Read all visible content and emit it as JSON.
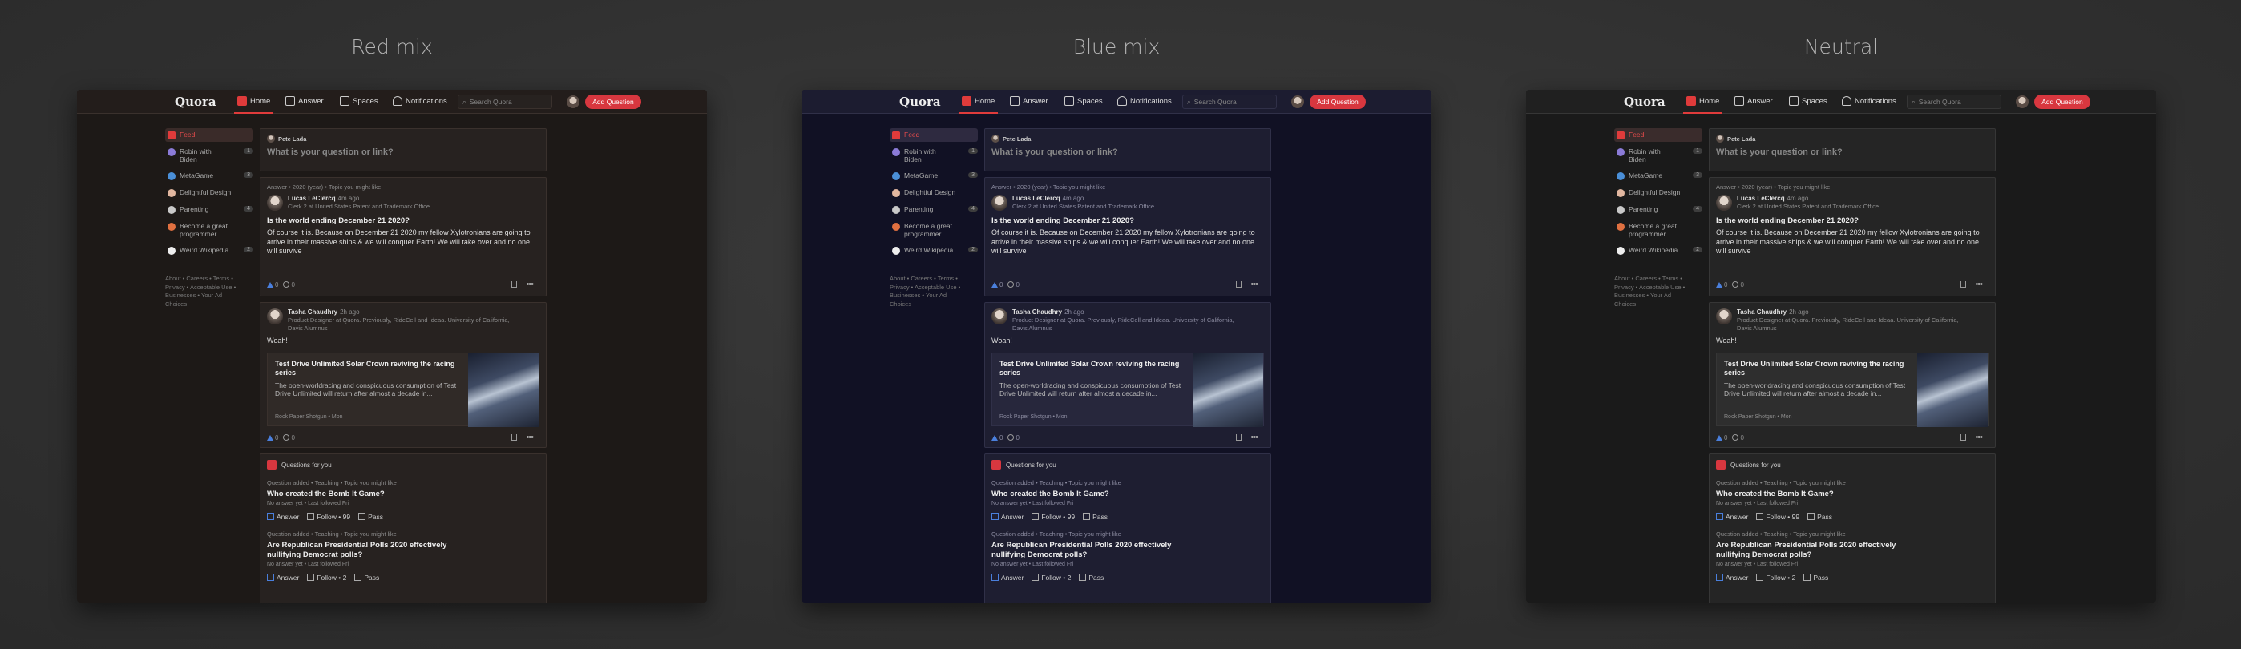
{
  "panels": [
    {
      "id": "red",
      "title": "Red mix"
    },
    {
      "id": "blue",
      "title": "Blue mix"
    },
    {
      "id": "neutral",
      "title": "Neutral"
    }
  ],
  "header": {
    "logo": "Quora",
    "nav": [
      "Home",
      "Answer",
      "Spaces",
      "Notifications"
    ],
    "search_placeholder": "Search Quora",
    "add_question": "Add Question"
  },
  "sidebar": {
    "items": [
      {
        "label": "Feed",
        "count": ""
      },
      {
        "label": "Robin with Biden",
        "count": "1"
      },
      {
        "label": "MetaGame",
        "count": "3"
      },
      {
        "label": "Delightful Design",
        "count": ""
      },
      {
        "label": "Parenting",
        "count": "4"
      },
      {
        "label": "Become a great programmer",
        "count": ""
      },
      {
        "label": "Weird Wikipedia",
        "count": "2"
      }
    ],
    "footer": "About • Careers • Terms • Privacy • Acceptable Use • Businesses • Your Ad Choices"
  },
  "ask": {
    "user": "Pete Lada",
    "placeholder": "What is your question or link?"
  },
  "post1": {
    "meta": "Answer • 2020 (year) • Topic you might like",
    "author": "Lucas LeClercq",
    "time": "4m ago",
    "cred": "Clerk 2 at United States Patent and Trademark Office",
    "title": "Is the world ending December 21 2020?",
    "body": "Of course it is. Because on December 21 2020 my fellow Xylotronians are going to arrive in their massive ships & we will conquer Earth! We will take over and no one will survive",
    "upvotes": "0",
    "comments": "0"
  },
  "post2": {
    "author": "Tasha Chaudhry",
    "time": "2h ago",
    "cred": "Product Designer at Quora. Previously, RideCell and Ideaa. University of California, Davis Alumnus",
    "body": "Woah!",
    "link_title": "Test Drive Unlimited Solar Crown reviving the racing series",
    "link_desc": "The open-worldracing and conspicuous consumption of Test Drive Unlimited will return after almost a decade in...",
    "link_source": "Rock Paper Shotgun • Mon",
    "upvotes": "0",
    "comments": "0"
  },
  "qfy": {
    "header": "Questions for you",
    "q1_meta": "Question added • Teaching • Topic you might like",
    "q1_title": "Who created the Bomb It Game?",
    "q1_sub": "No answer yet • Last followed Fri",
    "q1_answer": "Answer",
    "q1_follow": "Follow • 99",
    "q1_pass": "Pass",
    "q2_meta": "Question added • Teaching • Topic you might like",
    "q2_title": "Are Republican Presidential Polls 2020 effectively nullifying Democrat polls?",
    "q2_sub": "No answer yet • Last followed Fri",
    "q2_answer": "Answer",
    "q2_follow": "Follow • 2",
    "q2_pass": "Pass"
  },
  "colors": {
    "accent": "#d8373f",
    "upvote": "#4a7fdc"
  }
}
